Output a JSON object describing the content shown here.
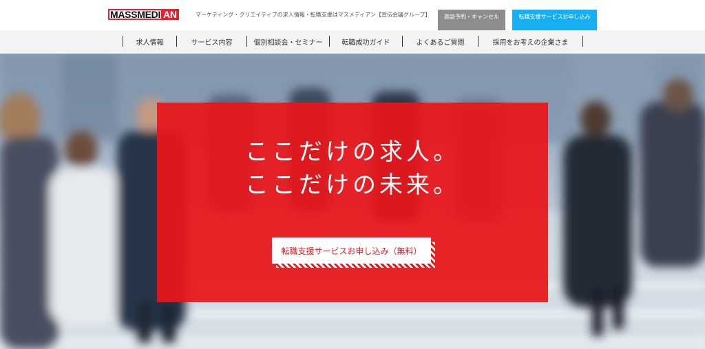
{
  "header": {
    "logo_main": "MASSMEDI",
    "logo_accent": "AN",
    "tagline": "マーケティング・クリエイティブの求人情報・転職支援はマスメディアン【宣伝会議グループ】",
    "cancel_button": "面談予約・キャンセル",
    "apply_button": "転職支援サービスお申し込み"
  },
  "nav": {
    "items": [
      {
        "label": "求人情報"
      },
      {
        "label": "サービス内容"
      },
      {
        "label": "個別相談会・セミナー"
      },
      {
        "label": "転職成功ガイド"
      },
      {
        "label": "よくあるご質問"
      },
      {
        "label": "採用をお考えの企業さま"
      }
    ]
  },
  "hero": {
    "headline_line1": "ここだけの求人。",
    "headline_line2": "ここだけの未来。",
    "cta_label": "転職支援サービスお申し込み（無料）"
  },
  "colors": {
    "brand_red": "#e8161a",
    "accent_blue": "#16aff2",
    "cancel_gray": "#8d8d8d"
  }
}
